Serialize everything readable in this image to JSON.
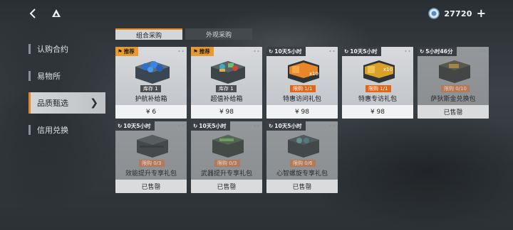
{
  "topbar": {
    "coins": "27720"
  },
  "colors": {
    "accent": "#e58a2b",
    "limit": "#e0661c",
    "timer_bg": "#3b3f43"
  },
  "sidebar": {
    "items": [
      {
        "label": "认购合约"
      },
      {
        "label": "易物所"
      },
      {
        "label": "品质甄选"
      },
      {
        "label": "信用兑换"
      }
    ]
  },
  "tabs": [
    {
      "label": "组合采购"
    },
    {
      "label": "外观采购"
    }
  ],
  "cards": [
    {
      "tag": "推荐",
      "name": "护航补给箱",
      "badge": "库存 1",
      "footer": "¥ 6"
    },
    {
      "tag": "推荐",
      "name": "超值补给箱",
      "badge": "库存 1",
      "footer": "¥ 98"
    },
    {
      "tag": "10天5小时",
      "name": "特惠访问礼包",
      "badge": "限购 1/1",
      "footer": "¥ 98"
    },
    {
      "tag": "10天5小时",
      "name": "特惠专访礼包",
      "badge": "限购 1/1",
      "footer": "¥ 98"
    },
    {
      "tag": "5小时46分",
      "name": "萨狄斯金兑换包",
      "badge": "限购 0/10",
      "footer": "已售罄"
    },
    {
      "tag": "10天5小时",
      "name": "效能提升专享礼包",
      "badge": "限购 0/3",
      "footer": "已售罄"
    },
    {
      "tag": "10天5小时",
      "name": "武器提升专享礼包",
      "badge": "限购 0/3",
      "footer": "已售罄"
    },
    {
      "tag": "10天5小时",
      "name": "心智螺旋专享礼包",
      "badge": "限购 0/6",
      "footer": "已售罄"
    }
  ]
}
